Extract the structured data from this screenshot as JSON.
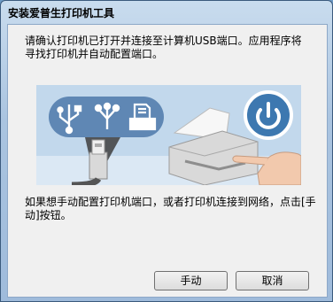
{
  "window": {
    "title": "安装爱普生打印机工具"
  },
  "dialog": {
    "message_top": "请确认打印机已打开并连接至计算机USB端口。应用程序将寻找打印机并自动配置端口。",
    "message_bottom": "如果想手动配置打印机端口，或者打印机连接到网络，点击[手动]按钮。"
  },
  "buttons": {
    "manual": "手动",
    "cancel": "取消"
  },
  "colors": {
    "banner_bg": "#c2d8ec",
    "icon_pill": "#5f87b4",
    "power_circle": "#3d78b0"
  }
}
